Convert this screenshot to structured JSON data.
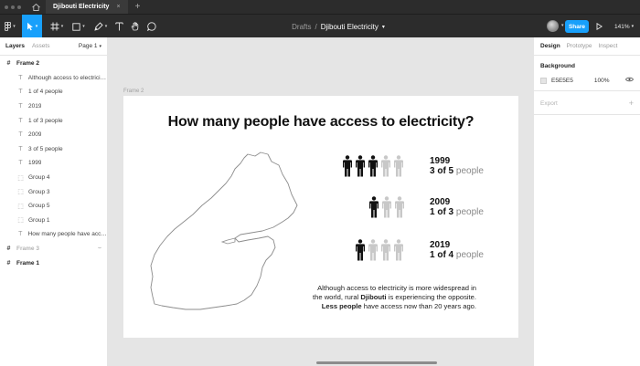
{
  "browser": {
    "tab_title": "Djibouti Electricity",
    "tab_close": "×",
    "new_tab": "+"
  },
  "toolbar": {
    "breadcrumb_root": "Drafts",
    "breadcrumb_separator": "/",
    "file_name": "Djibouti Electricity",
    "share_label": "Share",
    "zoom": "141%"
  },
  "left_panel": {
    "tabs": [
      "Layers",
      "Assets"
    ],
    "page_selector": "Page 1",
    "layers": [
      {
        "label": "Frame 2",
        "kind": "frame",
        "level": 0,
        "muted": false
      },
      {
        "label": "Although access to electricity...",
        "kind": "text",
        "level": 1,
        "muted": false
      },
      {
        "label": "1 of 4 people",
        "kind": "text",
        "level": 1,
        "muted": false
      },
      {
        "label": "2019",
        "kind": "text",
        "level": 1,
        "muted": false
      },
      {
        "label": "1 of 3 people",
        "kind": "text",
        "level": 1,
        "muted": false
      },
      {
        "label": "2009",
        "kind": "text",
        "level": 1,
        "muted": false
      },
      {
        "label": "3 of 5 people",
        "kind": "text",
        "level": 1,
        "muted": false
      },
      {
        "label": "1999",
        "kind": "text",
        "level": 1,
        "muted": false
      },
      {
        "label": "Group 4",
        "kind": "group",
        "level": 1,
        "muted": false
      },
      {
        "label": "Group 3",
        "kind": "group",
        "level": 1,
        "muted": false
      },
      {
        "label": "Group 5",
        "kind": "group",
        "level": 1,
        "muted": false
      },
      {
        "label": "Group 1",
        "kind": "group",
        "level": 1,
        "muted": false
      },
      {
        "label": "How many people have acces...",
        "kind": "text",
        "level": 1,
        "muted": false
      },
      {
        "label": "Frame 3",
        "kind": "frame",
        "level": 0,
        "muted": true
      },
      {
        "label": "Frame 1",
        "kind": "frame",
        "level": 0,
        "muted": false
      }
    ]
  },
  "right_panel": {
    "tabs": [
      "Design",
      "Prototype",
      "Inspect"
    ],
    "background_title": "Background",
    "background_color": "E5E5E5",
    "background_opacity": "100%",
    "export_title": "Export"
  },
  "canvas": {
    "frame_label": "Frame 2",
    "title": "How many people have access to electricity?",
    "stats": [
      {
        "year": "1999",
        "ratio": "3 of 5",
        "unit": "people",
        "filled": 3,
        "total": 5
      },
      {
        "year": "2009",
        "ratio": "1 of 3",
        "unit": "people",
        "filled": 1,
        "total": 3
      },
      {
        "year": "2019",
        "ratio": "1 of 4",
        "unit": "people",
        "filled": 1,
        "total": 4
      }
    ],
    "caption": {
      "line1": "Although access to electricity is more widespread in",
      "line2_pre": "the world, rural ",
      "line2_bold": "Djibouti",
      "line2_post": " is experiencing the opposite.",
      "line3_bold": "Less people",
      "line3_post": " have access now than 20 years ago."
    },
    "colors": {
      "filled": "#111111",
      "empty": "#c8c8c8"
    }
  },
  "help_label": "?"
}
